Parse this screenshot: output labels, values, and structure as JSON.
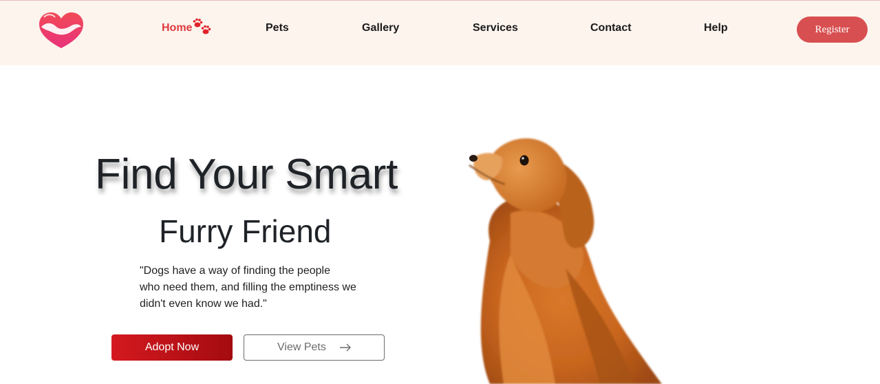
{
  "header": {
    "logo_icon": "heart-hand-logo-icon",
    "nav": [
      {
        "label": "Home",
        "active": true
      },
      {
        "label": "Pets"
      },
      {
        "label": "Gallery"
      },
      {
        "label": "Services"
      },
      {
        "label": "Contact"
      },
      {
        "label": "Help"
      }
    ],
    "paw_icon": "paw-prints-icon",
    "register_label": "Register"
  },
  "hero": {
    "title": "Find Your Smart",
    "subtitle": "Furry Friend",
    "quote_lines": [
      "\"Dogs have a way of finding the people",
      "who need them, and filling the emptiness we",
      "didn't even know we had.\""
    ],
    "adopt_label": "Adopt Now",
    "view_label": "View Pets",
    "view_arrow_icon": "arrow-right-icon",
    "image": "fluffy-orange-dog-photo"
  },
  "colors": {
    "nav_background": "#fdf4ee",
    "accent": "#e0393e",
    "register_button": "#d84f51",
    "adopt_button": "#c0141a"
  }
}
